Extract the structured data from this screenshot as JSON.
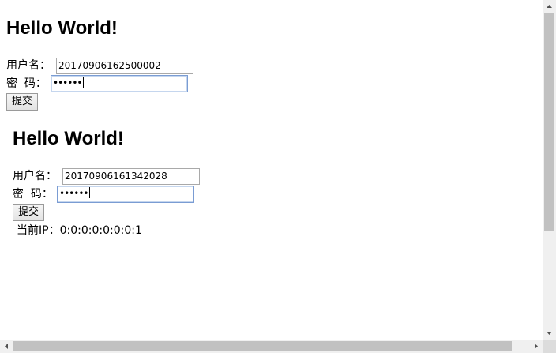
{
  "form1": {
    "heading": "Hello World!",
    "username_label": "用户名：",
    "username_value": "20170906162500002",
    "password_label": "密  码：",
    "password_mask": "••••••",
    "submit_label": "提交"
  },
  "form2": {
    "heading": "Hello World!",
    "username_label": "用户名：",
    "username_value": "20170906161342028",
    "password_label": "密  码：",
    "password_mask": "••••••",
    "submit_label": "提交",
    "ip_label": "当前IP：",
    "ip_value": "0:0:0:0:0:0:0:1"
  }
}
